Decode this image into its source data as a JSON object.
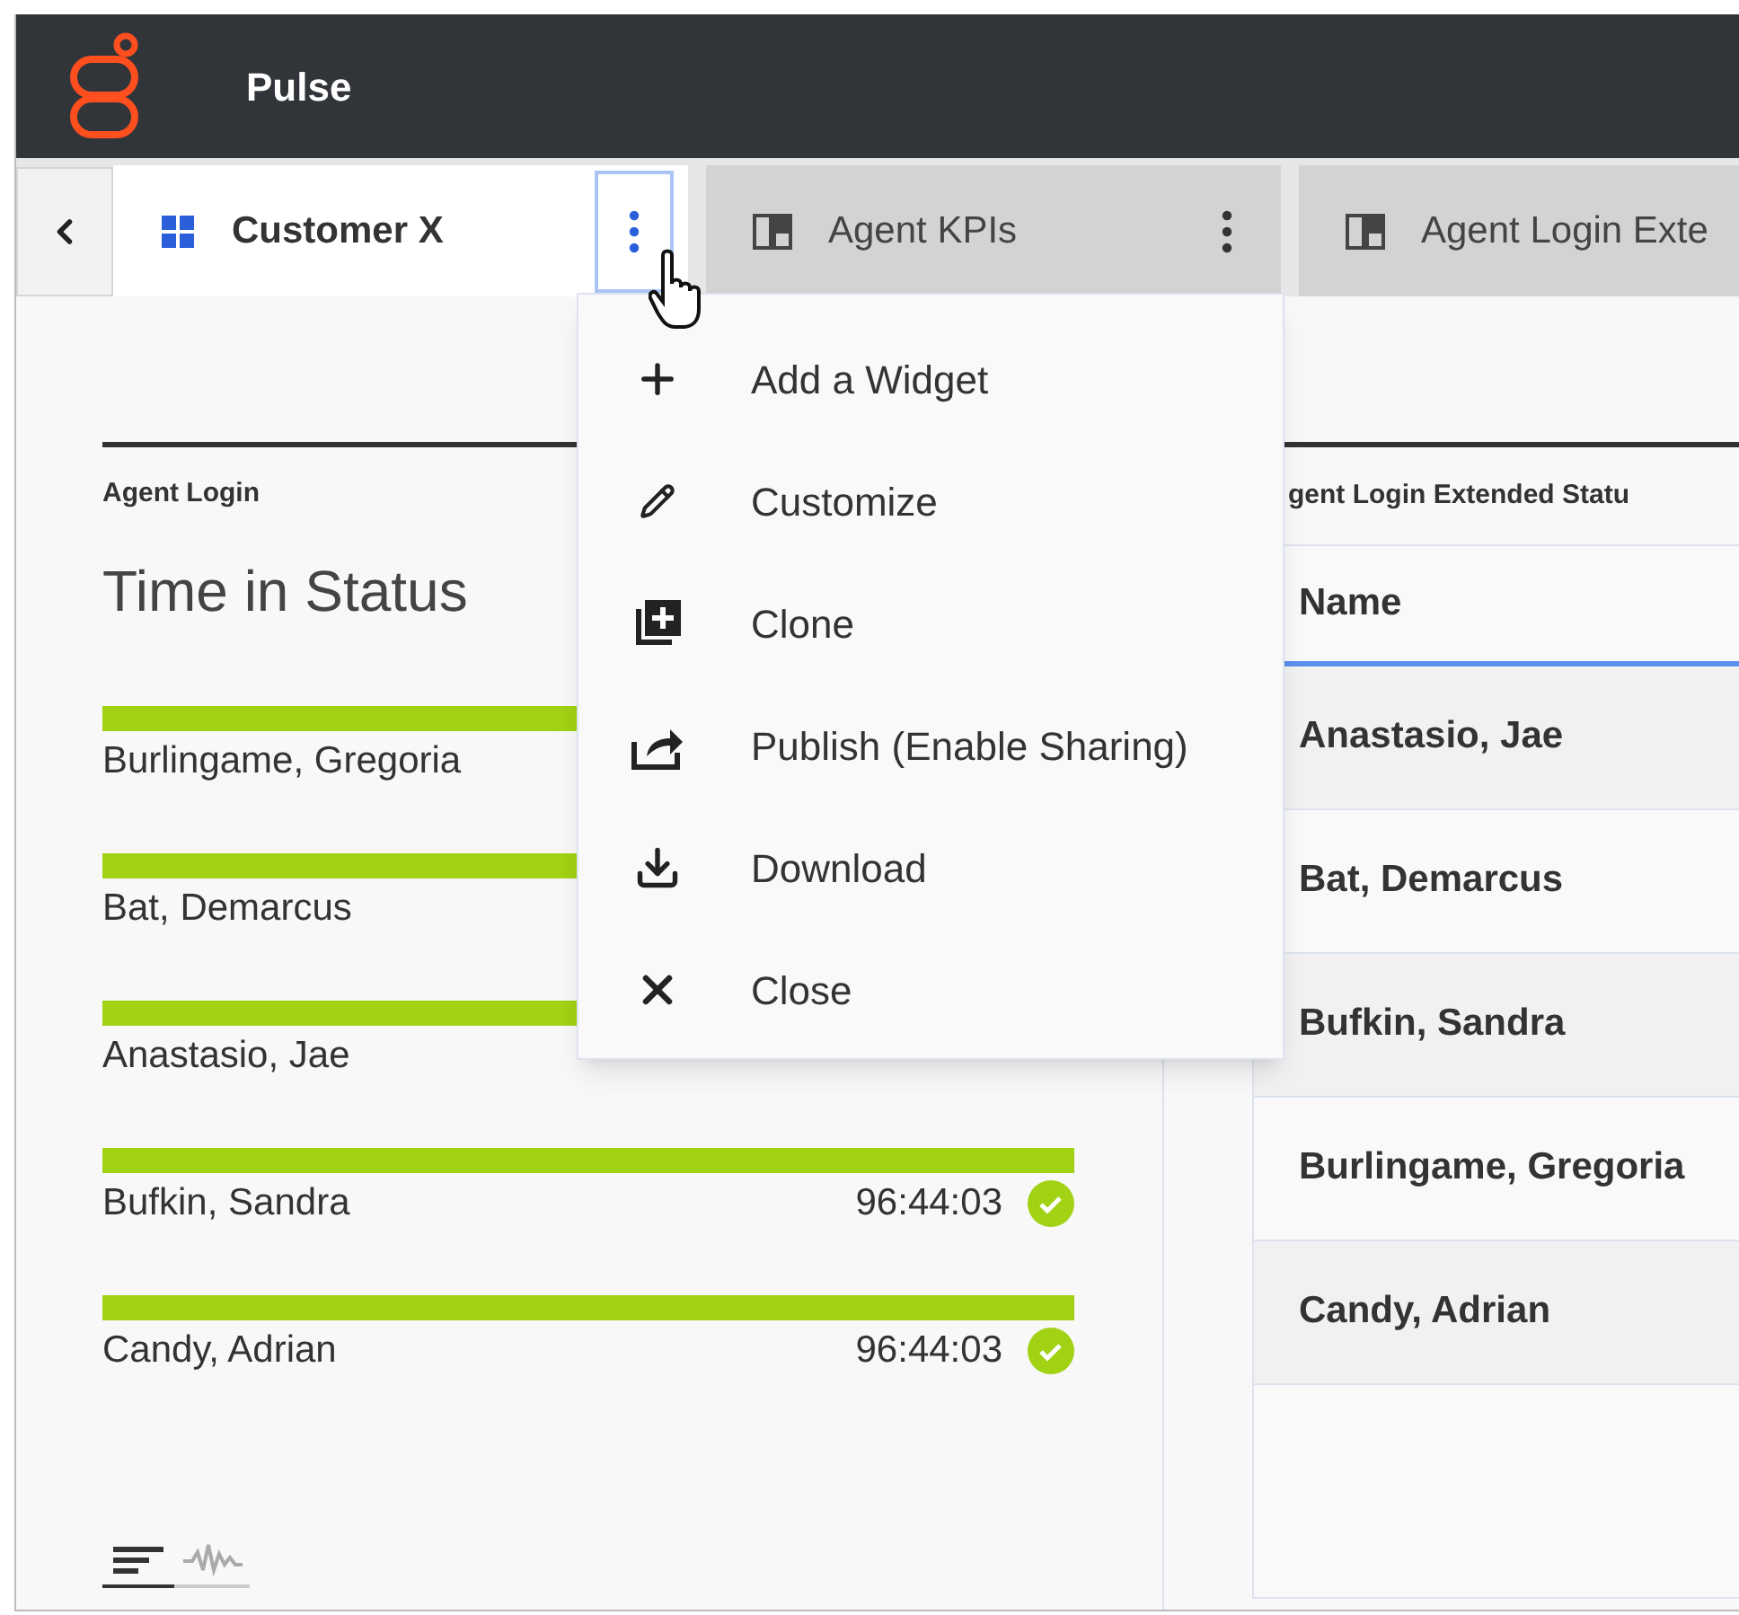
{
  "app": {
    "title": "Pulse"
  },
  "tabs": [
    {
      "label": "Customer X",
      "kind": "grid",
      "selected": true,
      "menu_focused": true
    },
    {
      "label": "Agent KPIs",
      "kind": "dashboard",
      "selected": false,
      "menu_focused": false
    },
    {
      "label": "Agent Login Exte",
      "kind": "dashboard",
      "selected": false
    }
  ],
  "menu": {
    "items": [
      {
        "label": "Add a Widget",
        "kind": "add"
      },
      {
        "label": "Customize",
        "kind": "edit"
      },
      {
        "label": "Clone",
        "kind": "clone"
      },
      {
        "label": "Publish (Enable Sharing)",
        "kind": "publish"
      },
      {
        "label": "Download",
        "kind": "download"
      },
      {
        "label": "Close",
        "kind": "close"
      }
    ]
  },
  "left_widget": {
    "header": "Agent Login",
    "title": "Time in Status",
    "rows": [
      {
        "name": "Burlingame, Gregoria"
      },
      {
        "name": "Bat, Demarcus"
      },
      {
        "name": "Anastasio, Jae"
      },
      {
        "name": "Bufkin, Sandra",
        "time": "96:44:03",
        "status_ok": true
      },
      {
        "name": "Candy, Adrian",
        "time": "96:44:03",
        "status_ok": true
      }
    ],
    "views": [
      {
        "kind": "bars",
        "selected": true
      },
      {
        "kind": "wave",
        "selected": false
      }
    ]
  },
  "right_widget": {
    "header": "gent Login Extended Statu",
    "columns": [
      "Name"
    ],
    "rows": [
      {
        "name": "Anastasio, Jae"
      },
      {
        "name": "Bat, Demarcus"
      },
      {
        "name": "Bufkin, Sandra"
      },
      {
        "name": "Burlingame, Gregoria"
      },
      {
        "name": "Candy, Adrian"
      }
    ]
  }
}
